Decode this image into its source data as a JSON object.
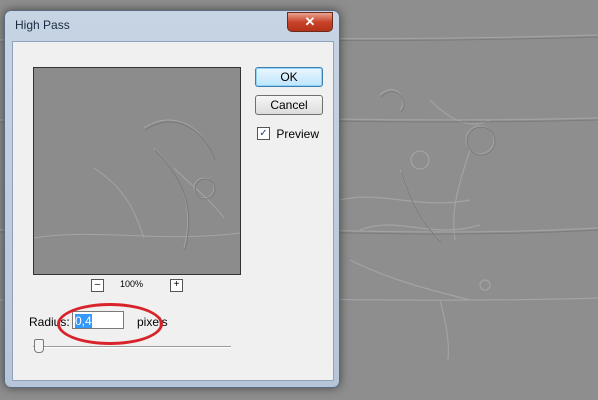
{
  "dialog": {
    "title": "High Pass",
    "close_icon": "✕",
    "ok_label": "OK",
    "cancel_label": "Cancel",
    "preview_label": "Preview",
    "preview_checked": true,
    "zoom_out_label": "–",
    "zoom_in_label": "+",
    "zoom_level": "100%",
    "radius_label": "Radius:",
    "radius_value": "0,4",
    "units_label": "pixels"
  },
  "colors": {
    "background": "#8e8e8e",
    "highlight_ring": "#d9232a",
    "selection": "#3399ff"
  }
}
